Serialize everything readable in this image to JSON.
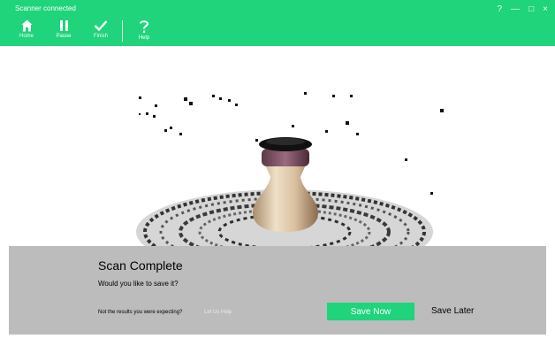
{
  "window": {
    "title": "Scanner connected",
    "help_glyph": "?",
    "minimize_glyph": "—",
    "maximize_glyph": "□",
    "close_glyph": "×"
  },
  "toolbar": {
    "home_label": "Home",
    "pause_label": "Pause",
    "finish_label": "Finish",
    "help_label": "Help",
    "help_icon": "question-mark-icon"
  },
  "viewport": {
    "content": "3d-scan-preview: vase on turntable point cloud"
  },
  "dialog": {
    "title": "Scan Complete",
    "message": "Would you like to save it?",
    "hint": "Not the results you were expecting?",
    "help_link": "Let Us Help",
    "save_now": "Save Now",
    "save_later": "Save Later"
  },
  "colors": {
    "accent": "#1fd47a",
    "panel": "#bcbcbc",
    "text": "#000000"
  }
}
